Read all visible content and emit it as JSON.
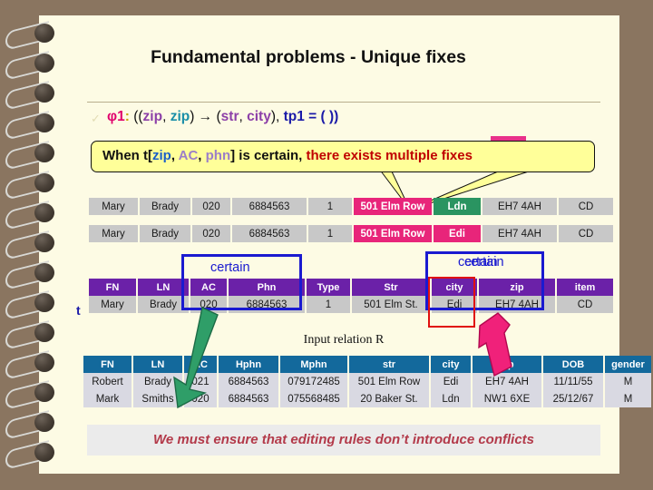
{
  "slide": {
    "title": "Fundamental problems - Unique fixes",
    "bullet1": {
      "phi": "φ1",
      "colon": ":",
      "open": " ((",
      "zip1": "zip",
      "comma1": ", ",
      "zip2": "zip",
      "arrow": ") → (",
      "str": "str",
      "comma2": ", ",
      "city": "city",
      "close": "), ",
      "tp": "tp1 = ( ))"
    },
    "callout": {
      "pre": "When t[",
      "zip": "zip",
      "sep1": ", ",
      "ac": "AC",
      "sep2": ", ",
      "phn": "phn",
      "mid": "]  is certain, ",
      "emphasis": "there exists multiple fixes"
    },
    "input_relation_label": "Input relation R",
    "tuple_label": "t",
    "certain_left": "certain",
    "certain_right_a": "certain",
    "certain_right_b": "certain",
    "banner": "We must ensure that editing rules don’t introduce conflicts"
  },
  "fix_rows": [
    {
      "cells": [
        "Mary",
        "Brady",
        "020",
        "6884563",
        "1",
        "501 Elm Row",
        "Ldn",
        "EH7 4AH",
        "CD"
      ],
      "styles": [
        "",
        "",
        "",
        "",
        "",
        "pink",
        "green",
        "",
        ""
      ]
    },
    {
      "cells": [
        "Mary",
        "Brady",
        "020",
        "6884563",
        "1",
        "501 Elm Row",
        "Edi",
        "EH7 4AH",
        "CD"
      ],
      "styles": [
        "",
        "",
        "",
        "",
        "",
        "pink",
        "pink",
        "",
        ""
      ]
    }
  ],
  "middle_table": {
    "headers": [
      "FN",
      "LN",
      "AC",
      "Phn",
      "Type",
      "Str",
      "city",
      "zip",
      "item"
    ],
    "rows": [
      [
        "Mary",
        "Brady",
        "020",
        "6884563",
        "1",
        "501 Elm St.",
        "Edi",
        "EH7 4AH",
        "CD"
      ]
    ]
  },
  "bottom_table": {
    "headers": [
      "FN",
      "LN",
      "AC",
      "Hphn",
      "Mphn",
      "str",
      "city",
      "zip",
      "DOB",
      "gender"
    ],
    "rows": [
      [
        "Robert",
        "Brady",
        "021",
        "6884563",
        "079172485",
        "501 Elm Row",
        "Edi",
        "EH7 4AH",
        "11/11/55",
        "M"
      ],
      [
        "Mark",
        "Smiths",
        "020",
        "6884563",
        "075568485",
        "20 Baker St.",
        "Ldn",
        "NW1 6XE",
        "25/12/67",
        "M"
      ]
    ]
  },
  "colors": {
    "page": "#fdfbe4",
    "desk": "#8a7560",
    "callout_bg": "#ffff99",
    "purple_header": "#6b21a8",
    "blue_header": "#13699c",
    "pink_cell": "#e8257a",
    "green_cell": "#2a9461",
    "annotation_blue": "#1a1ad0",
    "annotation_red": "#e01010",
    "green_arrow": "#2f9e68",
    "pink_arrow": "#f0217a",
    "banner_text": "#b33a4a",
    "emphasis_red": "#c00000"
  }
}
